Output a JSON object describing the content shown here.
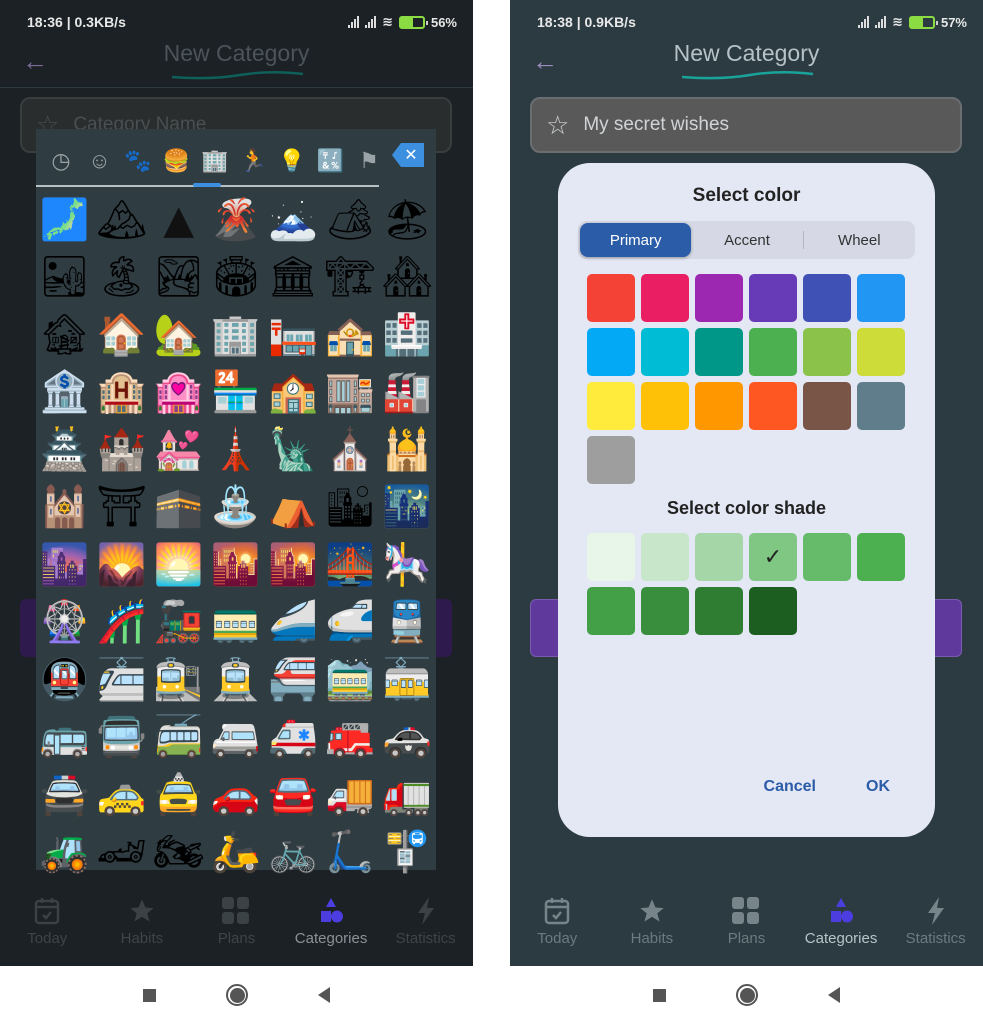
{
  "left": {
    "status": {
      "time": "18:36 | 0.3KB/s",
      "battery": "56%"
    },
    "appbar": {
      "title": "New Category",
      "back_icon": "arrow-left"
    },
    "name_field": {
      "placeholder": "Category Name",
      "icon": "star-outline"
    },
    "emoji_picker": {
      "categories": [
        {
          "name": "recent",
          "icon": "clock-icon",
          "glyph": "◷"
        },
        {
          "name": "smileys",
          "icon": "smiley-icon",
          "glyph": "☺"
        },
        {
          "name": "animals",
          "icon": "paw-icon",
          "glyph": "🐾"
        },
        {
          "name": "food",
          "icon": "burger-icon",
          "glyph": "🍔"
        },
        {
          "name": "travel",
          "icon": "buildings-icon",
          "glyph": "🏢",
          "active": true
        },
        {
          "name": "activities",
          "icon": "running-icon",
          "glyph": "🏃"
        },
        {
          "name": "objects",
          "icon": "lightbulb-icon",
          "glyph": "💡"
        },
        {
          "name": "symbols",
          "icon": "symbols-icon",
          "glyph": "🔣"
        },
        {
          "name": "flags",
          "icon": "flag-icon",
          "glyph": "⚑"
        }
      ],
      "backspace_label": "✕",
      "emojis": [
        "🗾",
        "🏔",
        "▲",
        "🌋",
        "🗻",
        "🏕",
        "🏖",
        "🏜",
        "🏝",
        "🏞",
        "🏟",
        "🏛",
        "🏗",
        "🏘",
        "🏚",
        "🏠",
        "🏡",
        "🏢",
        "🏣",
        "🏤",
        "🏥",
        "🏦",
        "🏨",
        "🏩",
        "🏪",
        "🏫",
        "🏬",
        "🏭",
        "🏯",
        "🏰",
        "💒",
        "🗼",
        "🗽",
        "⛪",
        "🕌",
        "🕍",
        "⛩",
        "🕋",
        "⛲",
        "⛺",
        "🏙",
        "🌃",
        "🌆",
        "🌄",
        "🌅",
        "🌇",
        "🌇",
        "🌉",
        "🎠",
        "🎡",
        "🎢",
        "🚂",
        "🚃",
        "🚄",
        "🚅",
        "🚆",
        "🚇",
        "🚈",
        "🚉",
        "🚊",
        "🚝",
        "🚞",
        "🚋",
        "🚌",
        "🚍",
        "🚎",
        "🚐",
        "🚑",
        "🚒",
        "🚓",
        "🚔",
        "🚕",
        "🚖",
        "🚗",
        "🚘",
        "🚚",
        "🚛",
        "🚜",
        "🏎",
        "🏍",
        "🛵",
        "🚲",
        "🛴",
        "🚏"
      ]
    },
    "nav": [
      {
        "label": "Today",
        "icon": "calendar-check-icon"
      },
      {
        "label": "Habits",
        "icon": "star-icon"
      },
      {
        "label": "Plans",
        "icon": "grid-icon"
      },
      {
        "label": "Categories",
        "icon": "shapes-icon",
        "active": true
      },
      {
        "label": "Statistics",
        "icon": "bolt-icon"
      }
    ]
  },
  "right": {
    "status": {
      "time": "18:38 | 0.9KB/s",
      "battery": "57%"
    },
    "appbar": {
      "title": "New Category",
      "back_icon": "arrow-left"
    },
    "name_field": {
      "value": "My secret wishes",
      "icon": "star-outline"
    },
    "dialog": {
      "title": "Select color",
      "tabs": [
        {
          "label": "Primary",
          "active": true
        },
        {
          "label": "Accent"
        },
        {
          "label": "Wheel"
        }
      ],
      "primary_colors": [
        "#f44336",
        "#e91e63",
        "#9c27b0",
        "#673ab7",
        "#3f51b5",
        "#2196f3",
        "#03a9f4",
        "#00bcd4",
        "#009688",
        "#4caf50",
        "#8bc34a",
        "#cddc39",
        "#ffeb3b",
        "#ffc107",
        "#ff9800",
        "#ff5722",
        "#795548",
        "#607d8b",
        "#9e9e9e"
      ],
      "shade_title": "Select color shade",
      "shades": [
        "#e8f5e9",
        "#c8e6c9",
        "#a5d6a7",
        "#81c784",
        "#66bb6a",
        "#4caf50",
        "#43a047",
        "#388e3c",
        "#2e7d32",
        "#1b5e20"
      ],
      "selected_shade": 3,
      "check_glyph": "✓",
      "cancel_label": "Cancel",
      "ok_label": "OK"
    },
    "nav": [
      {
        "label": "Today",
        "icon": "calendar-check-icon"
      },
      {
        "label": "Habits",
        "icon": "star-icon"
      },
      {
        "label": "Plans",
        "icon": "grid-icon"
      },
      {
        "label": "Categories",
        "icon": "shapes-icon",
        "active": true
      },
      {
        "label": "Statistics",
        "icon": "bolt-icon"
      }
    ]
  },
  "colors": {
    "accent_blue": "#2a5ca8",
    "picker_blue": "#3d8fe0",
    "nav_active": "#4b3de0"
  }
}
